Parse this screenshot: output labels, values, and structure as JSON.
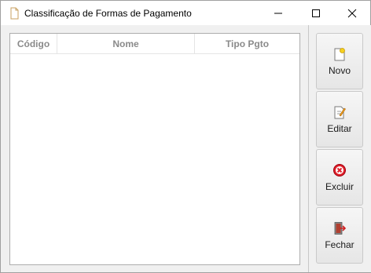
{
  "window": {
    "title": "Classificação de Formas de Pagamento"
  },
  "table": {
    "columns": [
      "Código",
      "Nome",
      "Tipo Pgto"
    ],
    "rows": []
  },
  "buttons": {
    "novo": "Novo",
    "editar": "Editar",
    "excluir": "Excluir",
    "fechar": "Fechar"
  },
  "icons": {
    "app": "document-icon",
    "novo": "new-document-icon",
    "editar": "edit-document-icon",
    "excluir": "delete-icon",
    "fechar": "exit-door-icon"
  },
  "colors": {
    "header_text": "#8a8a8a",
    "delete_red": "#e0202a"
  }
}
